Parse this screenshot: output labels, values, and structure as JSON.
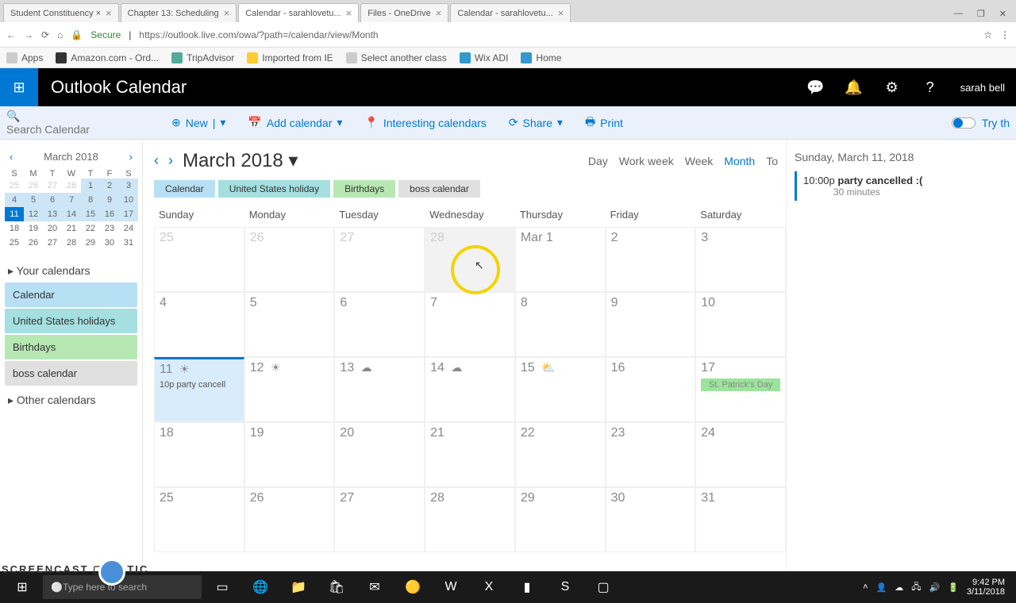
{
  "browser": {
    "tabs": [
      {
        "label": "Student Constituency ×"
      },
      {
        "label": "Chapter 13: Scheduling"
      },
      {
        "label": "Calendar - sarahlovetu..."
      },
      {
        "label": "Files - OneDrive"
      },
      {
        "label": "Calendar - sarahlovetu..."
      }
    ],
    "min": "—",
    "restore": "❐",
    "close": "✕",
    "back": "←",
    "forward": "→",
    "reload": "⟳",
    "home_icon": "⌂",
    "secure": "Secure",
    "lock": "🔒",
    "url": "https://outlook.live.com/owa/?path=/calendar/view/Month",
    "star": "☆",
    "menu": "⋮"
  },
  "bookmarks": {
    "apps": "Apps",
    "items": [
      "Amazon.com - Ord...",
      "TripAdvisor",
      "Imported from IE",
      "Select another class",
      "Wix ADI",
      "Home"
    ]
  },
  "header": {
    "title": "Outlook Calendar",
    "user": "sarah bell",
    "waffle": "⊞",
    "chat": "💬",
    "bell": "🔔",
    "gear": "⚙",
    "help": "?"
  },
  "toolbar": {
    "search_ph": "Search Calendar",
    "new": "New",
    "add_cal": "Add calendar",
    "interesting": "Interesting calendars",
    "share": "Share",
    "print": "Print",
    "try": "Try th",
    "down": "▾",
    "plus": "⊕",
    "cal_icon": "📅",
    "pin": "📍",
    "refresh": "⟳",
    "print_icon": "🖶"
  },
  "sidebar": {
    "month_label": "March 2018",
    "prev": "‹",
    "next": "›",
    "dow": [
      "S",
      "M",
      "T",
      "W",
      "T",
      "F",
      "S"
    ],
    "mini_rows": [
      [
        "25",
        "26",
        "27",
        "28",
        "1",
        "2",
        "3"
      ],
      [
        "4",
        "5",
        "6",
        "7",
        "8",
        "9",
        "10"
      ],
      [
        "11",
        "12",
        "13",
        "14",
        "15",
        "16",
        "17"
      ],
      [
        "18",
        "19",
        "20",
        "21",
        "22",
        "23",
        "24"
      ],
      [
        "25",
        "26",
        "27",
        "28",
        "29",
        "30",
        "31"
      ]
    ],
    "your_cals": "Your calendars",
    "cals": [
      {
        "label": "Calendar",
        "cls": "cal-blue"
      },
      {
        "label": "United States holidays",
        "cls": "cal-teal"
      },
      {
        "label": "Birthdays",
        "cls": "cal-green"
      },
      {
        "label": "boss calendar",
        "cls": "cal-gray"
      }
    ],
    "other": "Other calendars"
  },
  "month": {
    "prev": "‹",
    "next": "›",
    "title": "March 2018",
    "down": "▾",
    "views": [
      "Day",
      "Work week",
      "Week",
      "Month",
      "To"
    ],
    "chips": [
      {
        "label": "Calendar",
        "cls": "cal-blue"
      },
      {
        "label": "United States holiday",
        "cls": "cal-teal"
      },
      {
        "label": "Birthdays",
        "cls": "cal-green"
      },
      {
        "label": "boss calendar",
        "cls": "cal-gray"
      }
    ],
    "dow": [
      "Sunday",
      "Monday",
      "Tuesday",
      "Wednesday",
      "Thursday",
      "Friday",
      "Saturday"
    ],
    "weeks": [
      [
        {
          "n": "25",
          "dim": true
        },
        {
          "n": "26",
          "dim": true
        },
        {
          "n": "27",
          "dim": true
        },
        {
          "n": "28",
          "dim": true,
          "wed28": true
        },
        {
          "n": "Mar 1"
        },
        {
          "n": "2"
        },
        {
          "n": "3"
        }
      ],
      [
        {
          "n": "4"
        },
        {
          "n": "5"
        },
        {
          "n": "6"
        },
        {
          "n": "7"
        },
        {
          "n": "8"
        },
        {
          "n": "9"
        },
        {
          "n": "10"
        }
      ],
      [
        {
          "n": "11",
          "sel": true,
          "w": "☀",
          "evt": "10p party cancell"
        },
        {
          "n": "12",
          "w": "☀"
        },
        {
          "n": "13",
          "w": "☁"
        },
        {
          "n": "14",
          "w": "☁"
        },
        {
          "n": "15",
          "w": "⛅"
        },
        {
          "n": "16"
        },
        {
          "n": "17",
          "green": "St. Patrick's Day"
        }
      ],
      [
        {
          "n": "18"
        },
        {
          "n": "19"
        },
        {
          "n": "20"
        },
        {
          "n": "21"
        },
        {
          "n": "22"
        },
        {
          "n": "23"
        },
        {
          "n": "24"
        }
      ],
      [
        {
          "n": "25"
        },
        {
          "n": "26"
        },
        {
          "n": "27"
        },
        {
          "n": "28"
        },
        {
          "n": "29"
        },
        {
          "n": "30"
        },
        {
          "n": "31"
        }
      ]
    ]
  },
  "agenda": {
    "date": "Sunday, March 11, 2018",
    "time": "10:00p",
    "title": "party cancelled :(",
    "dur": "30 minutes"
  },
  "taskbar": {
    "search_ph": "Type here to search",
    "time": "9:42 PM",
    "date": "3/11/2018",
    "screencast": "SCREENCAST ▢ MATIC"
  }
}
